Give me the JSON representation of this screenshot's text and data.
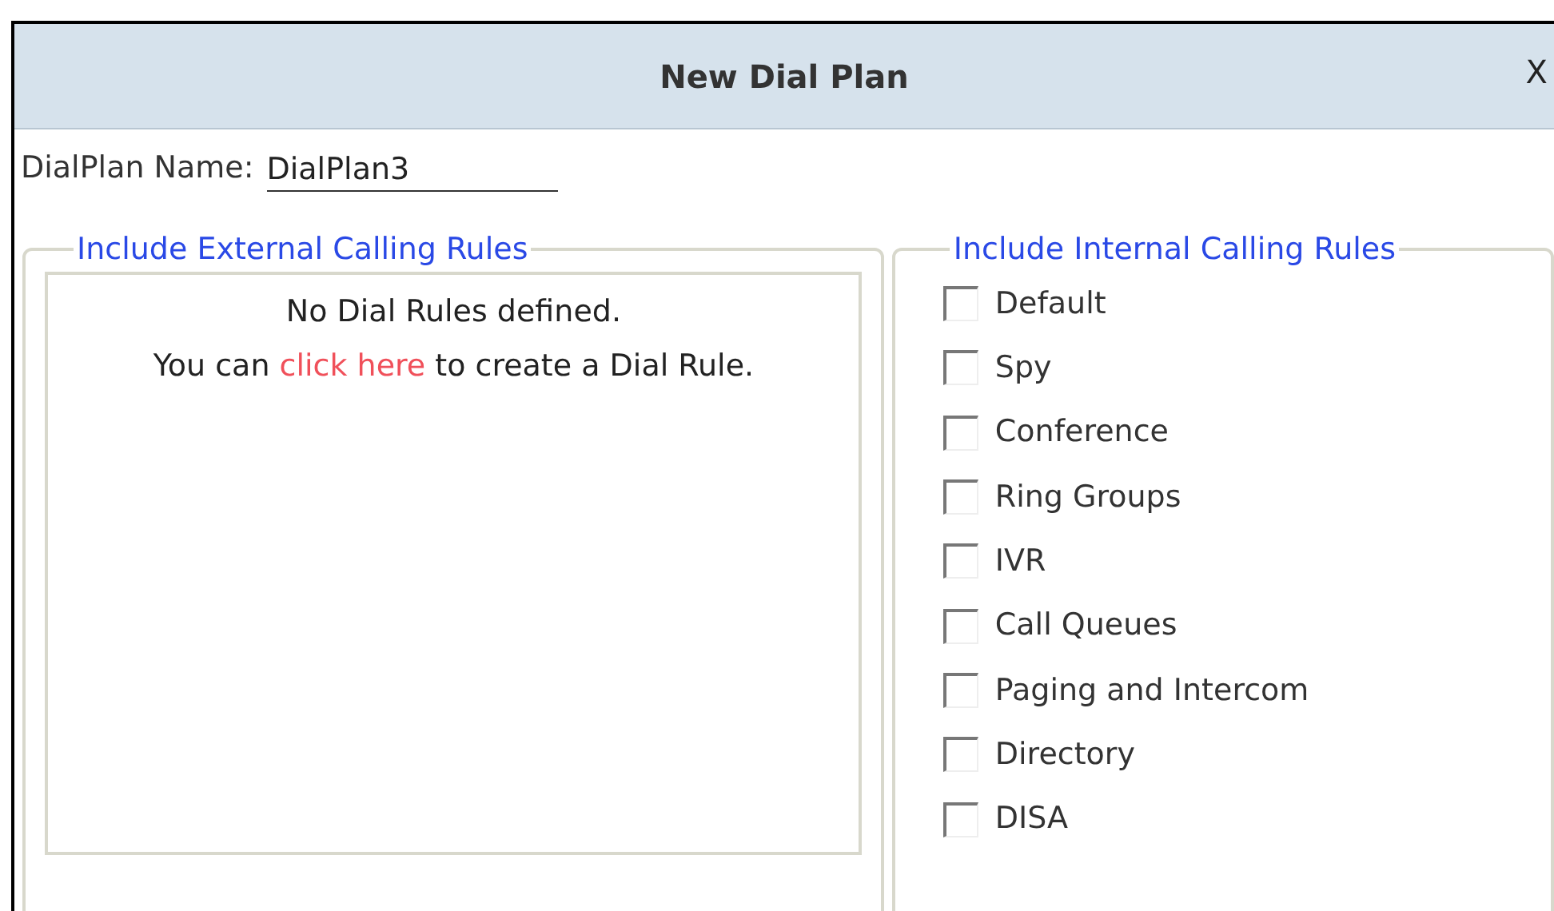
{
  "dialog": {
    "title": "New Dial Plan",
    "close": "X"
  },
  "name_field": {
    "label": "DialPlan Name:",
    "value": "DialPlan3"
  },
  "external": {
    "legend": "Include External Calling Rules",
    "empty_title": "No Dial Rules defined.",
    "message_before": "You can",
    "link": "click here",
    "message_after": "to create a Dial Rule."
  },
  "internal": {
    "legend": "Include Internal Calling Rules",
    "rules": [
      {
        "label": "Default",
        "checked": false
      },
      {
        "label": "Spy",
        "checked": false
      },
      {
        "label": "Conference",
        "checked": false
      },
      {
        "label": "Ring Groups",
        "checked": false
      },
      {
        "label": "IVR",
        "checked": false
      },
      {
        "label": "Call Queues",
        "checked": false
      },
      {
        "label": "Paging and Intercom",
        "checked": false
      },
      {
        "label": "Directory",
        "checked": false
      },
      {
        "label": "DISA",
        "checked": false
      }
    ]
  }
}
